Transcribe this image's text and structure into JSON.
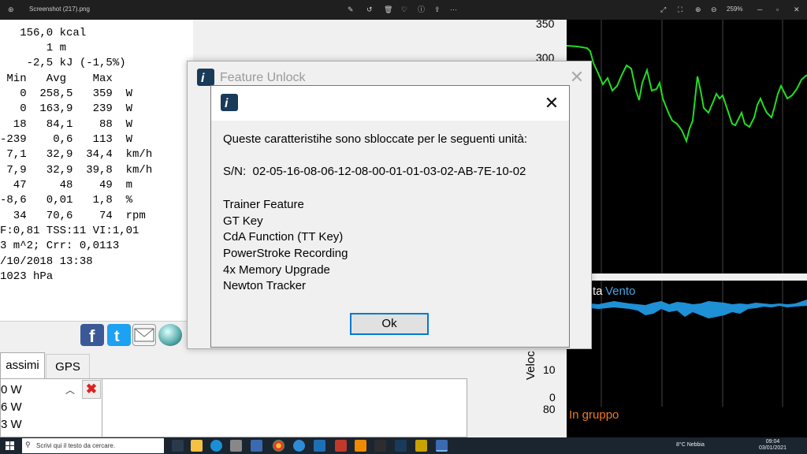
{
  "viewer": {
    "title": "Screenshot (217).png",
    "zoom": "259%"
  },
  "stats": {
    "lines": [
      "   156,0 kcal",
      "       1 m",
      "    -2,5 kJ (-1,5%)",
      " Min   Avg    Max",
      "   0  258,5   359  W",
      "   0  163,9   239  W",
      "  18   84,1    88  W",
      "-239    0,6   113  W",
      " 7,1   32,9  34,4  km/h",
      " 7,9   32,9  39,8  km/h",
      "  47     48    49  m",
      "-8,6   0,01   1,8  %",
      "  34   70,6    74  rpm",
      "F:0,81 TSS:11 VI:1,01",
      "3 m^2; Crr: 0,0113",
      "/10/2018 13:38",
      "1023 hPa"
    ]
  },
  "tabs": {
    "tab_massimi": "assimi",
    "tab_gps": "GPS"
  },
  "list": {
    "items": [
      "0 W",
      "6 W",
      "3 W"
    ]
  },
  "chart": {
    "yticks_top": [
      "350",
      "300"
    ],
    "yticks_bottom": [
      "10",
      "0",
      "80"
    ],
    "label_vento_prefix": "ta",
    "label_vento": "Vento",
    "label_gruppo": "In gruppo",
    "label_velo": "Veloc",
    "colors": {
      "power_line": "#22dd22",
      "wind": "#1e90d6",
      "gruppo": "#f07820"
    }
  },
  "outer_dialog": {
    "title": "Feature Unlock"
  },
  "inner_dialog": {
    "message": "Queste caratteristihe sono sbloccate per le seguenti unità:",
    "serial": "S/N:  02-05-16-08-06-12-08-00-01-01-03-02-AB-7E-10-02",
    "features": [
      "Trainer Feature",
      "GT Key",
      "CdA Function (TT Key)",
      "PowerStroke Recording",
      "4x Memory Upgrade",
      "Newton Tracker"
    ],
    "ok_label": "Ok"
  },
  "taskbar": {
    "search_placeholder": "Scrivi qui il testo da cercare.",
    "weather": "8°C  Nebbia",
    "time": "09:04",
    "date": "03/01/2021"
  }
}
